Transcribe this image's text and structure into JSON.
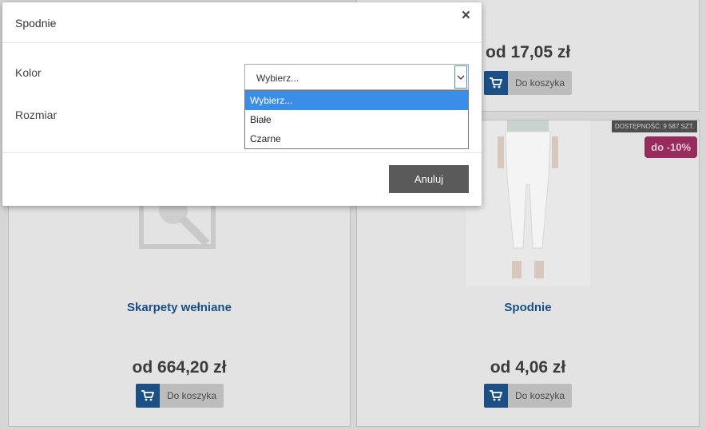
{
  "background": {
    "top_card": {
      "price": "od 17,05 zł",
      "cart_label": "Do koszyka"
    },
    "left_card": {
      "title": "Skarpety wełniane",
      "price": "od 664,20 zł",
      "cart_label": "Do koszyka"
    },
    "right_card": {
      "availability_badge": "DOSTĘPNOŚĆ: 9 587 SZT.",
      "discount_badge": "do -10%",
      "title": "Spodnie",
      "price": "od 4,06 zł",
      "cart_label": "Do koszyka"
    }
  },
  "modal": {
    "title": "Spodnie",
    "close_symbol": "×",
    "fields": {
      "color_label": "Kolor",
      "size_label": "Rozmiar"
    },
    "color_select": {
      "value": "Wybierz...",
      "options": [
        "Wybierz...",
        "Białe",
        "Czarne"
      ],
      "selected_index": 0
    },
    "cancel_label": "Anuluj"
  },
  "colors": {
    "accent": "#3b8ee8",
    "cart_icon_bg": "#1c4f85",
    "title_link": "#1a4f86",
    "discount": "#962c5c"
  }
}
